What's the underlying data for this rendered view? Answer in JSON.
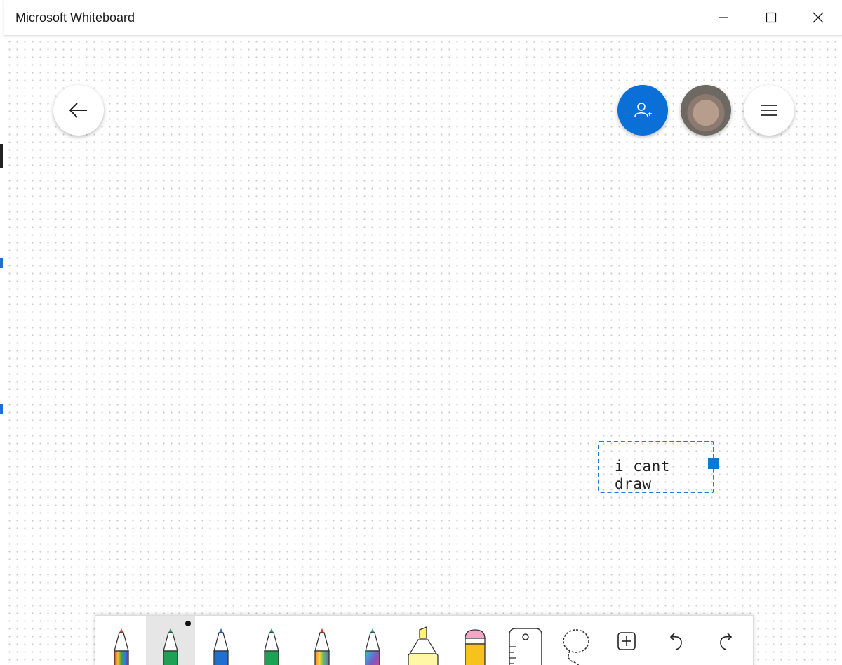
{
  "window": {
    "title": "Microsoft Whiteboard"
  },
  "icons": {
    "back": "back-arrow-icon",
    "invite": "add-person-icon",
    "menu": "hamburger-menu-icon",
    "minimize": "minimize-icon",
    "maximize": "maximize-icon",
    "close": "close-icon",
    "add": "add-icon",
    "undo": "undo-icon",
    "redo": "redo-icon"
  },
  "colors": {
    "accent": "#0a6fd6",
    "selection": "#1f7ad6"
  },
  "canvas": {
    "text_box": {
      "text": "i cant draw"
    }
  },
  "toolbar": {
    "tools": [
      {
        "name": "rainbow-pen",
        "tip_color": "#e53935",
        "body": "rainbow",
        "selected": false
      },
      {
        "name": "green-pen",
        "tip_color": "#1e9e55",
        "body": "#1ea055",
        "selected": true
      },
      {
        "name": "blue-pen",
        "tip_color": "#1e6fd0",
        "body": "#1e6fd0",
        "selected": false
      },
      {
        "name": "green-pen-2",
        "tip_color": "#1e9e55",
        "body": "#1ea055",
        "selected": false
      },
      {
        "name": "rainbow-pen-2",
        "tip_color": "#e53935",
        "body": "rainbow",
        "selected": false
      },
      {
        "name": "galaxy-pen",
        "tip_color": "#1aa3a3",
        "body": "galaxy",
        "selected": false
      },
      {
        "name": "highlighter",
        "tip_color": "#fff27a",
        "body": "#fff7a6",
        "selected": false
      },
      {
        "name": "eraser",
        "tip_color": "#f4a6c8",
        "body": "#f6c21b",
        "selected": false
      },
      {
        "name": "ruler",
        "selected": false
      },
      {
        "name": "lasso",
        "selected": false
      },
      {
        "name": "add",
        "selected": false
      },
      {
        "name": "undo",
        "selected": false
      },
      {
        "name": "redo",
        "selected": false
      }
    ]
  }
}
